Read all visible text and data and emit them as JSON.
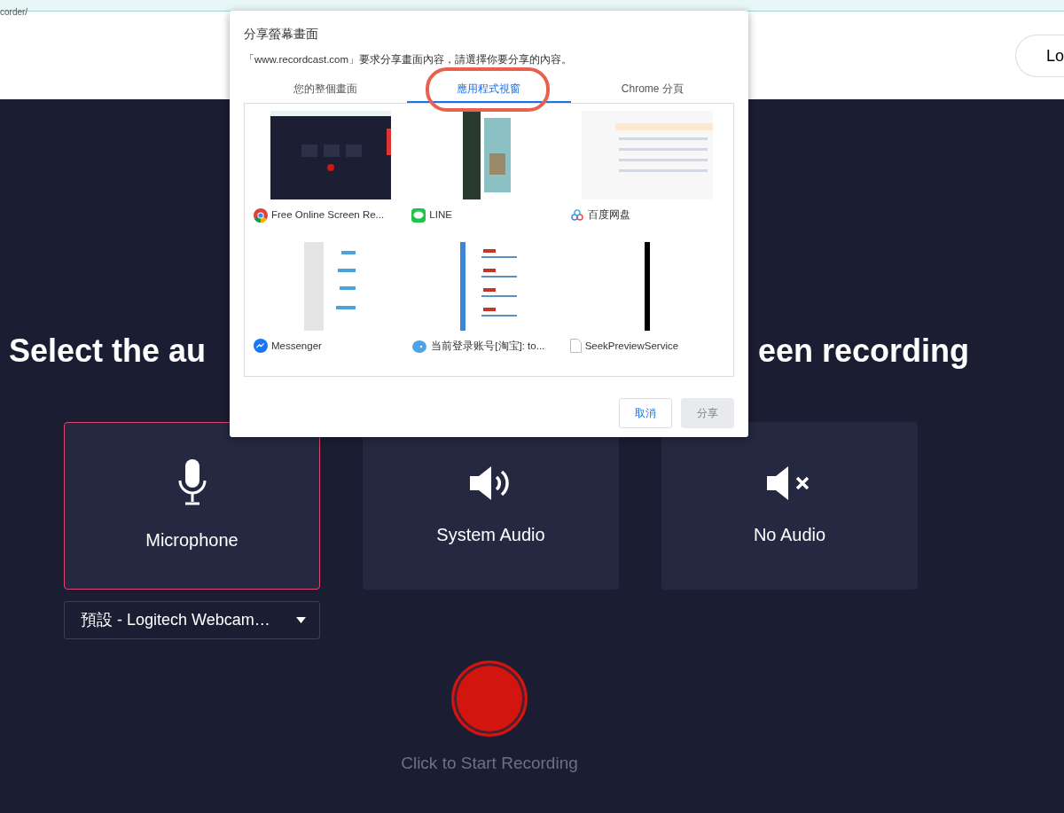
{
  "address_bar": {
    "text": "corder/"
  },
  "header": {
    "login_button": "Lo"
  },
  "heading": {
    "left": "Select the au",
    "right": "een recording"
  },
  "sources": [
    {
      "kind": "microphone",
      "label": "Microphone",
      "selected": true
    },
    {
      "kind": "system",
      "label": "System Audio",
      "selected": false
    },
    {
      "kind": "none",
      "label": "No Audio",
      "selected": false
    }
  ],
  "device_select": {
    "value": "預設 - Logitech Webcam…"
  },
  "record": {
    "label": "Click to Start Recording"
  },
  "dialog": {
    "title": "分享螢幕畫面",
    "message": "「www.recordcast.com」要求分享畫面內容，請選擇你要分享的內容。",
    "tabs": [
      {
        "label": "您的整個畫面",
        "selected": false
      },
      {
        "label": "應用程式視窗",
        "selected": true
      },
      {
        "label": "Chrome 分頁",
        "selected": false
      }
    ],
    "windows": [
      {
        "title": "Free Online Screen Re...",
        "kind": "browser",
        "selected": false
      },
      {
        "title": "LINE",
        "kind": "chat",
        "selected": false
      },
      {
        "title": "百度网盘",
        "kind": "cloud",
        "selected": false
      },
      {
        "title": "Messenger",
        "kind": "messenger",
        "selected": false
      },
      {
        "title": "当前登录账号[淘宝]: to...",
        "kind": "bubble",
        "selected": false
      },
      {
        "title": "SeekPreviewService",
        "kind": "file",
        "selected": false
      }
    ],
    "buttons": [
      {
        "label": "取消",
        "disabled": false
      },
      {
        "label": "分享",
        "disabled": true
      }
    ]
  }
}
